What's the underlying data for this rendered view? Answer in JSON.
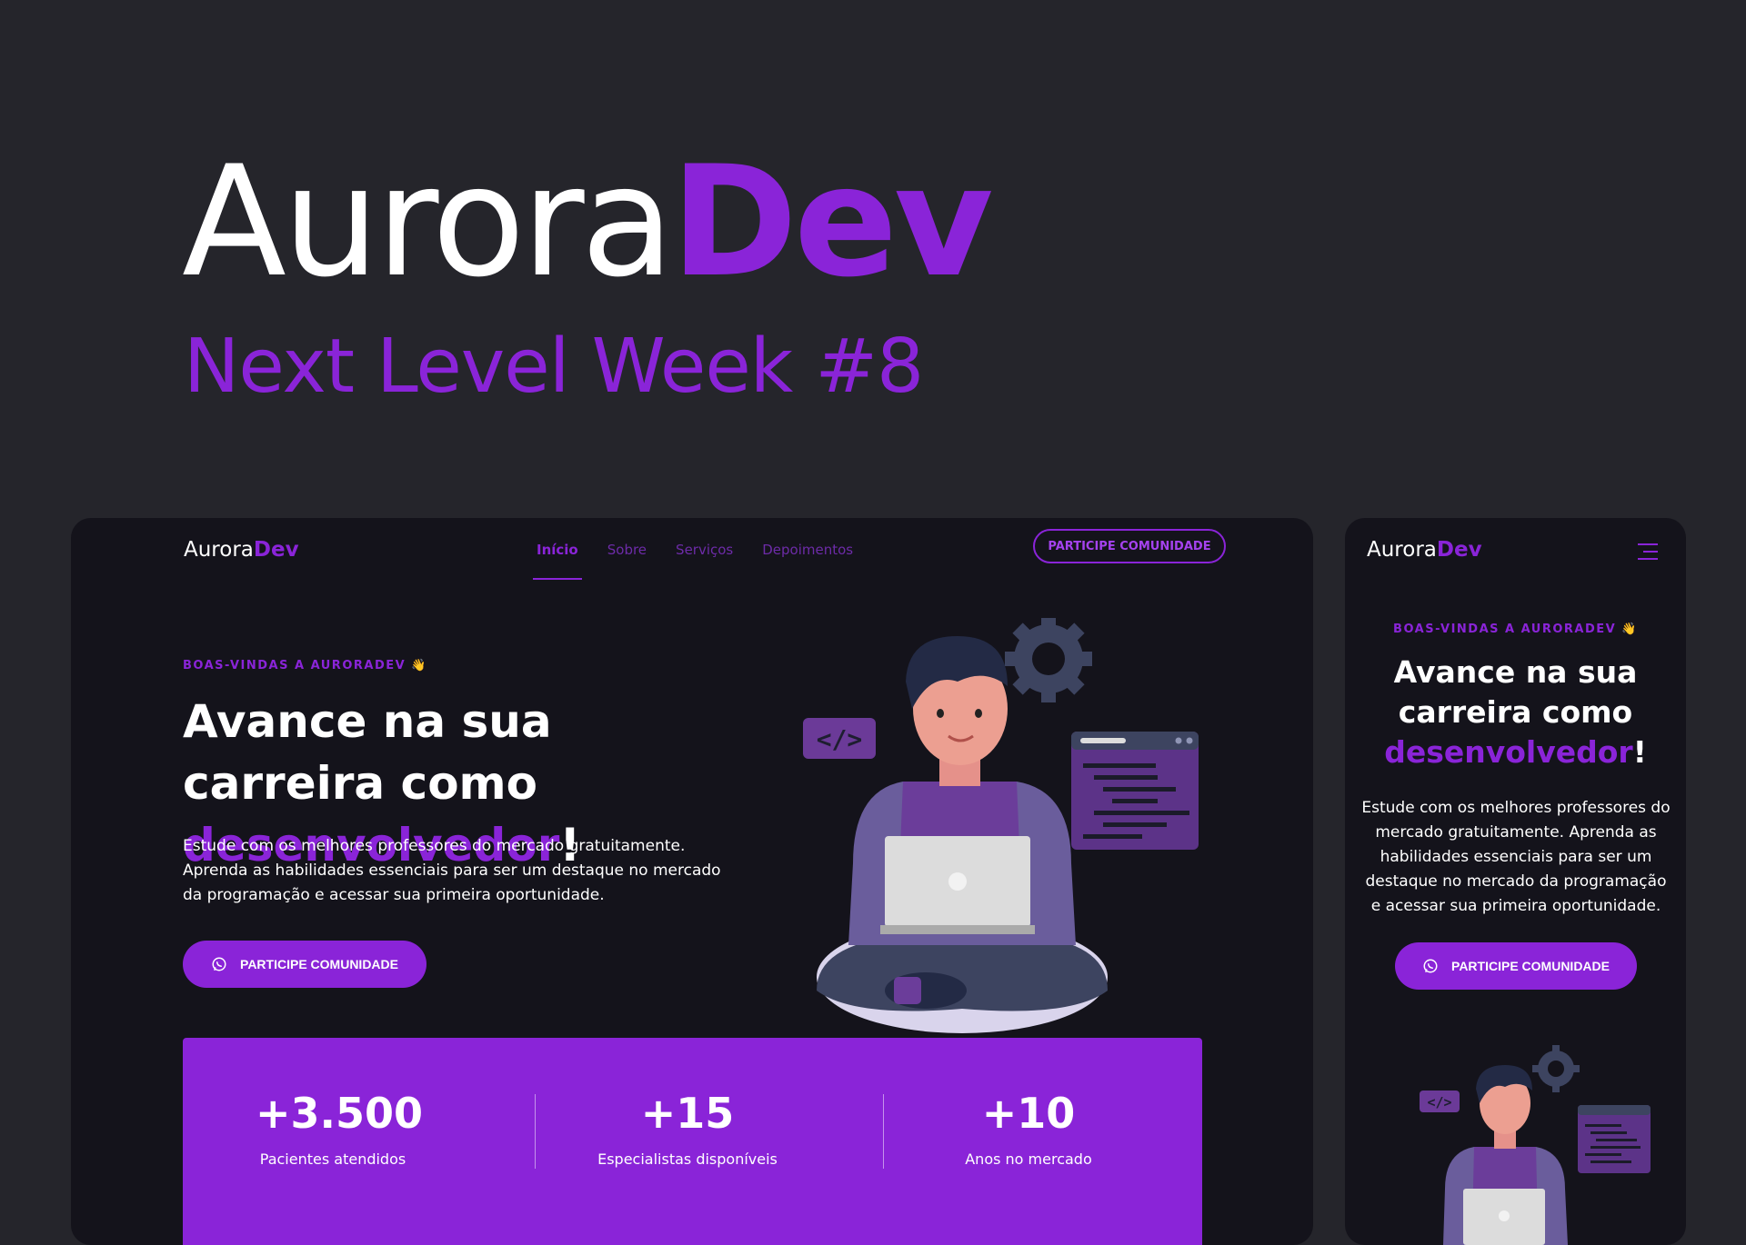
{
  "hero": {
    "title_main": "Aurora",
    "title_accent": "Dev",
    "subtitle": "Next Level Week #8"
  },
  "brand": {
    "name_main": "Aurora",
    "name_accent": "Dev"
  },
  "colors": {
    "accent": "#8a24d8",
    "background": "#25252b",
    "surface": "#14131b"
  },
  "desktop": {
    "nav": [
      {
        "label": "Início",
        "active": true
      },
      {
        "label": "Sobre"
      },
      {
        "label": "Serviços"
      },
      {
        "label": "Depoimentos"
      }
    ],
    "header_button": "PARTICIPE COMUNIDADE",
    "tag": "BOAS-VINDAS A AURORADEV 👋",
    "title_part1": "Avance na sua carreira como ",
    "title_accent": "desenvolvedor",
    "title_end": "!",
    "description": "Estude com os melhores professores do mercado gratuitamente. Aprenda as habilidades essenciais para ser um destaque no mercado da programação e acessar sua primeira oportunidade.",
    "cta": "PARTICIPE COMUNIDADE",
    "stats": [
      {
        "value": "+3.500",
        "label": "Pacientes atendidos"
      },
      {
        "value": "+15",
        "label": "Especialistas disponíveis"
      },
      {
        "value": "+10",
        "label": "Anos no mercado"
      }
    ]
  },
  "mobile": {
    "menu_icon": "hamburger-icon",
    "tag": "BOAS-VINDAS A AURORADEV 👋",
    "title_part1": "Avance na sua carreira como ",
    "title_accent": "desenvolvedor",
    "title_end": "!",
    "description": "Estude com os melhores professores do mercado gratuitamente. Aprenda as habilidades essenciais para ser um destaque no mercado da programação e acessar sua primeira oportunidade.",
    "cta": "PARTICIPE COMUNIDADE"
  }
}
